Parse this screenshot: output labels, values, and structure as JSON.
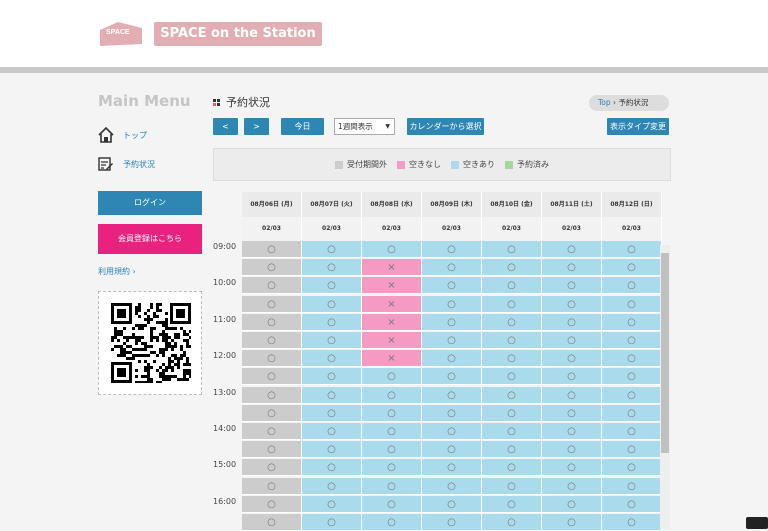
{
  "header": {
    "logo_mark": "SPACE",
    "logo_text": "SPACE on the Station"
  },
  "sidebar": {
    "title": "Main Menu",
    "links": [
      {
        "label": "トップ",
        "icon": "home-icon"
      },
      {
        "label": "予約状況",
        "icon": "calendar-edit-icon"
      }
    ],
    "login": "ログイン",
    "register": "会員登録はこちら",
    "terms": "利用規約"
  },
  "main": {
    "title": "予約状況",
    "breadcrumb": {
      "top": "Top",
      "current": "予約状況"
    },
    "prev": "<",
    "next": ">",
    "today": "今日",
    "view_select": "1週間表示",
    "calendar_select": "カレンダーから選択",
    "display_type": "表示タイプ変更",
    "legend": [
      {
        "label": "受付期間外",
        "color": "#cccccc"
      },
      {
        "label": "空きなし",
        "color": "#f59ac2"
      },
      {
        "label": "空きあり",
        "color": "#a9dbec"
      },
      {
        "label": "予約済み",
        "color": "#a3d89b"
      }
    ]
  },
  "calendar": {
    "dates": [
      "08月06日 (月)",
      "08月07日 (火)",
      "08月08日 (水)",
      "08月09日 (木)",
      "08月10日 (金)",
      "08月11日 (土)",
      "08月12日 (日)"
    ],
    "counts": [
      "02/03",
      "02/03",
      "02/03",
      "02/03",
      "02/03",
      "02/03",
      "02/03"
    ],
    "times": [
      "09:00",
      "10:00",
      "11:00",
      "12:00",
      "13:00",
      "14:00",
      "15:00",
      "16:00"
    ],
    "symbols": {
      "available": "○",
      "full": "×"
    },
    "rows": 16,
    "full_cells": [
      {
        "col": 2,
        "rows": [
          1,
          2,
          3,
          4,
          5,
          6
        ]
      }
    ],
    "outside_col": 0
  },
  "colors": {
    "accent": "#2e87b3",
    "pink": "#e8227e",
    "available": "#a9dbec",
    "full": "#f59ac2",
    "outside": "#cccccc"
  }
}
